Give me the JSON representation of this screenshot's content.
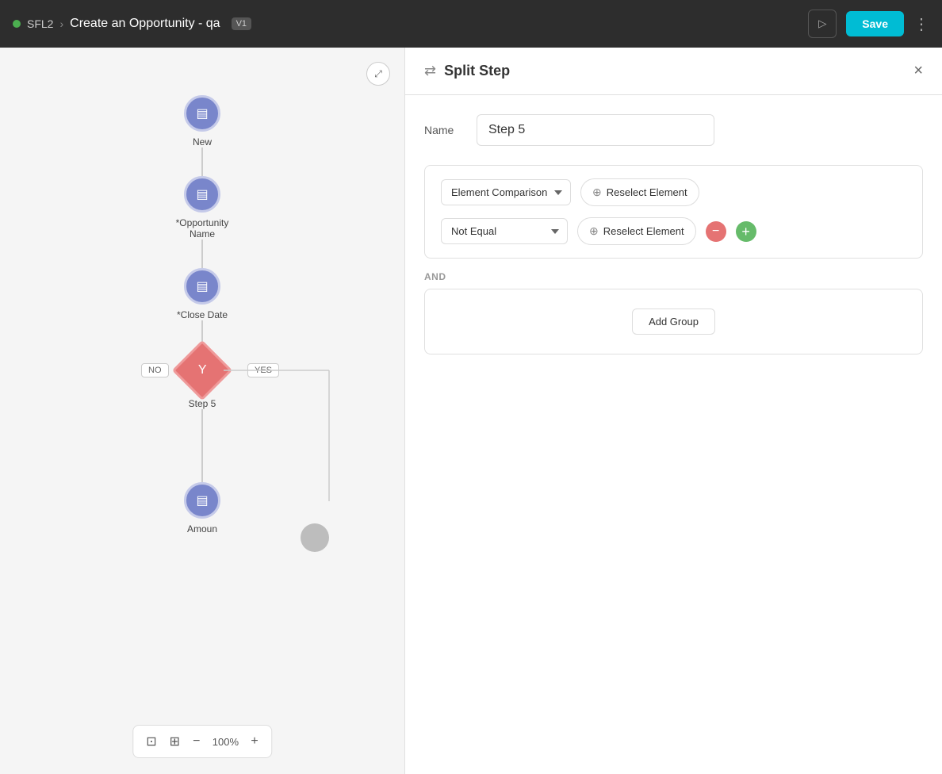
{
  "header": {
    "dot_color": "#4caf50",
    "sfl_label": "SFL2",
    "chevron": "›",
    "title": "Create an Opportunity - qa",
    "version": "V1",
    "play_icon": "▷",
    "save_label": "Save",
    "more_icon": "⋮"
  },
  "canvas": {
    "collapse_icon": "⤢",
    "nodes": [
      {
        "id": "new",
        "label": "New",
        "icon": "▤"
      },
      {
        "id": "opportunity-name",
        "label": "*Opportunity Name",
        "icon": "▤"
      },
      {
        "id": "close-date",
        "label": "*Close Date",
        "icon": "▤"
      },
      {
        "id": "step5",
        "label": "Step 5",
        "icon": "Y",
        "type": "diamond"
      },
      {
        "id": "amount",
        "label": "Amoun",
        "icon": "▤"
      }
    ],
    "yes_label": "YES",
    "no_label": "NO",
    "toolbar": {
      "fit_icon": "⊡",
      "map_icon": "⊞",
      "zoom_out": "−",
      "zoom_level": "100%",
      "zoom_in": "+"
    }
  },
  "panel": {
    "split_icon": "⇄",
    "title": "Split Step",
    "close_icon": "×",
    "name_label": "Name",
    "name_value": "Step 5",
    "conditions": [
      {
        "type_options": [
          "Element Comparison"
        ],
        "type_selected": "Element Comparison",
        "element_label": "Reselect Element",
        "show_actions": false
      },
      {
        "type_options": [
          "Not Equal"
        ],
        "type_selected": "Not Equal",
        "element_label": "Reselect Element",
        "show_actions": true
      }
    ],
    "and_label": "AND",
    "add_group_label": "Add Group"
  }
}
